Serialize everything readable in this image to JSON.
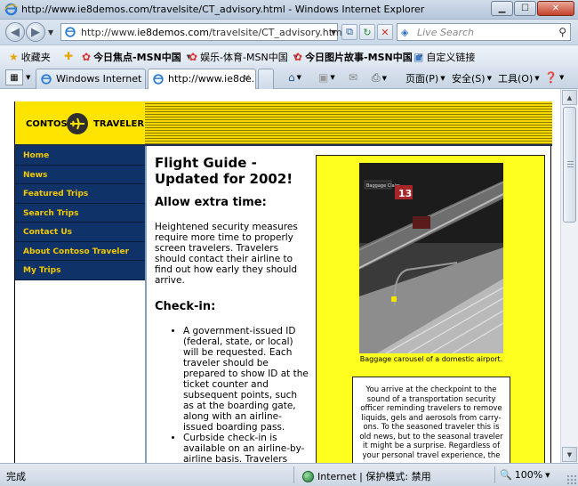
{
  "window": {
    "title": "http://www.ie8demos.com/travelsite/CT_advisory.html - Windows Internet Explorer"
  },
  "address": {
    "url_prefix": "http://www.",
    "url_domain": "ie8demos.com",
    "url_path": "/travelsite/CT_advisory.html",
    "search_placeholder": "Live Search"
  },
  "favorites": {
    "label": "收藏夹",
    "items": [
      {
        "label": "今日焦点-MSN中国"
      },
      {
        "label": "娱乐-体育-MSN中国"
      },
      {
        "label": "今日图片故事-MSN中国"
      },
      {
        "label": "自定义链接"
      }
    ]
  },
  "tabs": [
    {
      "label": "Windows Internet E..."
    },
    {
      "label": "http://www.ie8de..."
    }
  ],
  "commands": {
    "page": "页面(P)",
    "safety": "安全(S)",
    "tools": "工具(O)"
  },
  "site": {
    "logo_left": "CONTOSO",
    "logo_right": "TRAVELER",
    "nav": [
      "Home",
      "News",
      "Featured Trips",
      "Search Trips",
      "Contact Us",
      "About Contoso Traveler",
      "My Trips"
    ],
    "heading": "Flight Guide - Updated for 2002!",
    "section1_title": "Allow extra time:",
    "section1_text": "Heightened security measures require more time to properly screen travelers. Travelers should contact their airline to find out how early they should arrive.",
    "section2_title": "Check-in:",
    "checkin_items": [
      "A government-issued ID (federal, state, or local) will be requested. Each traveler should be prepared to show ID at the ticket counter and subsequent points, such as at the boarding gate, along with an airline-issued boarding pass.",
      "Curbside check-in is available on an airline-by-airline basis. Travelers should contact their airline to see if it is available at"
    ],
    "photo_sign": "Baggage Claim",
    "photo_number": "13",
    "photo_caption": "Baggage carousel of a domestic airport.",
    "infobox_text": "You arrive at the checkpoint to the sound of a transportation security officer reminding travelers to remove liquids, gels and aerosols from carry-ons. To the seasoned traveler this is old news, but to the seasonal traveler it might be a surprise. Regardless of your personal travel experience, the"
  },
  "status": {
    "text": "完成",
    "zone": "Internet | 保护模式: 禁用",
    "zoom": "100%"
  },
  "colors": {
    "nav_bg": "#0f3368",
    "nav_text": "#f2c800",
    "banner_yellow": "#ffe400",
    "sidebox_yellow": "#ffff1f"
  }
}
